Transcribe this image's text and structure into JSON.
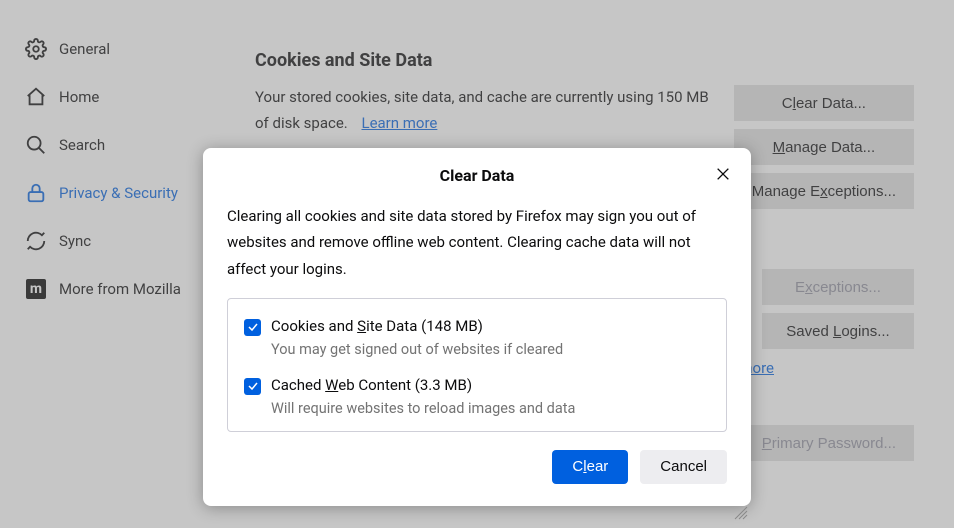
{
  "sidebar": {
    "items": [
      {
        "label": "General"
      },
      {
        "label": "Home"
      },
      {
        "label": "Search"
      },
      {
        "label": "Privacy & Security"
      },
      {
        "label": "Sync"
      },
      {
        "label": "More from Mozilla"
      }
    ]
  },
  "cookies_section": {
    "heading": "Cookies and Site Data",
    "desc": "Your stored cookies, site data, and cache are currently using 150 MB of disk space.",
    "learn_more": "Learn more",
    "buttons": {
      "clear_data": "Clear Data...",
      "manage_data": "Manage Data...",
      "manage_exceptions": "Manage Exceptions..."
    }
  },
  "logins_section": {
    "buttons": {
      "exceptions": "Exceptions...",
      "saved_logins": "Saved Logins..."
    },
    "learn_more": "arn more",
    "primary_pwd": "Primary Password..."
  },
  "modal": {
    "title": "Clear Data",
    "body": "Clearing all cookies and site data stored by Firefox may sign you out of websites and remove offline web content. Clearing cache data will not affect your logins.",
    "options": [
      {
        "label_pre": "Cookies and ",
        "label_ul": "S",
        "label_post": "ite Data (148 MB)",
        "sub": "You may get signed out of websites if cleared"
      },
      {
        "label_pre": "Cached ",
        "label_ul": "W",
        "label_post": "eb Content (3.3 MB)",
        "sub": "Will require websites to reload images and data"
      }
    ],
    "clear_btn_pre": "C",
    "clear_btn_ul": "l",
    "clear_btn_post": "ear",
    "cancel_btn": "Cancel"
  }
}
